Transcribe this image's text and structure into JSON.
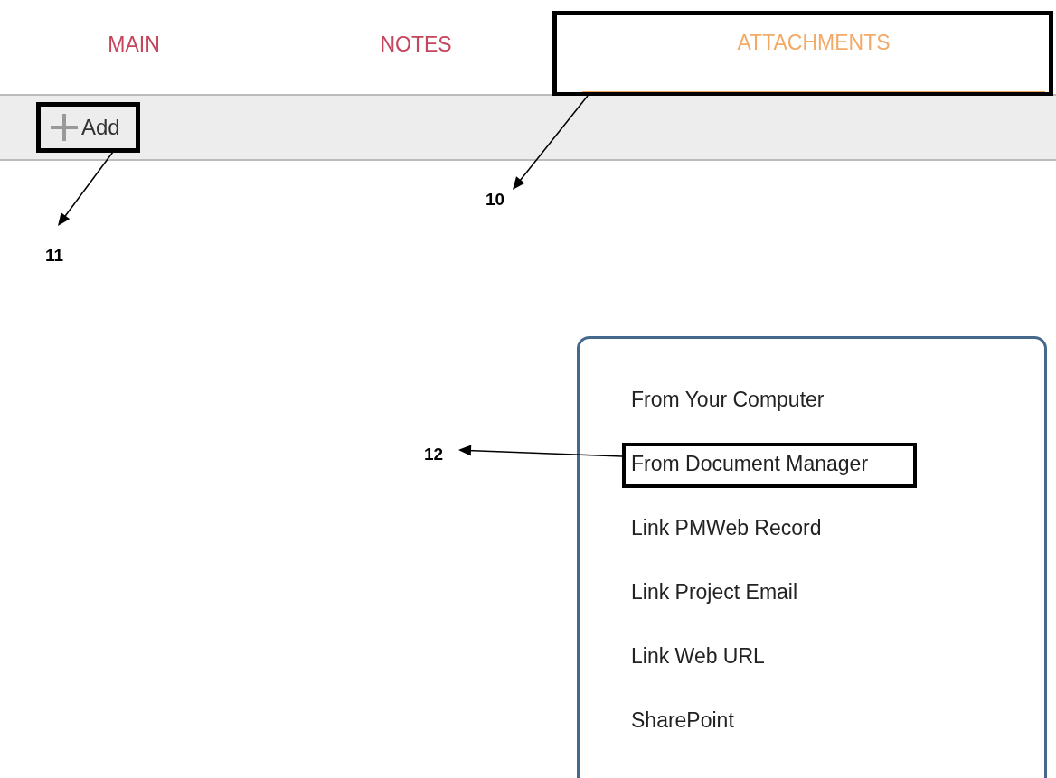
{
  "tabs": [
    {
      "label": "MAIN",
      "selected": false,
      "highlighted": false
    },
    {
      "label": "NOTES",
      "selected": false,
      "highlighted": false
    },
    {
      "label": "ATTACHMENTS",
      "selected": true,
      "highlighted": true
    }
  ],
  "toolbar": {
    "add_button": {
      "label": "Add",
      "highlighted": true
    }
  },
  "add_menu": {
    "items": [
      {
        "label": "From Your Computer",
        "highlighted": false
      },
      {
        "label": "From Document Manager",
        "highlighted": true
      },
      {
        "label": "Link PMWeb Record",
        "highlighted": false
      },
      {
        "label": "Link Project Email",
        "highlighted": false
      },
      {
        "label": "Link Web URL",
        "highlighted": false
      },
      {
        "label": "SharePoint",
        "highlighted": false
      }
    ]
  },
  "callouts": [
    {
      "label": "10"
    },
    {
      "label": "11"
    },
    {
      "label": "12"
    }
  ]
}
